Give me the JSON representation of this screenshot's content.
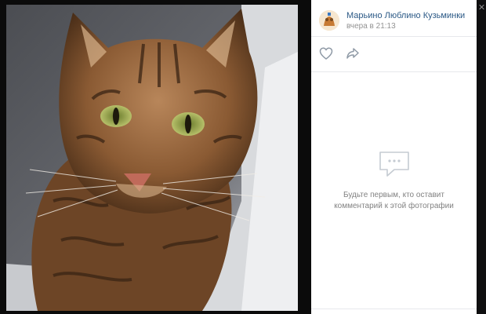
{
  "post": {
    "author": "Марьино Люблино Кузьминки",
    "date": "вчера в 21:13"
  },
  "icons": {
    "like": "heart-icon",
    "share": "share-arrow-icon",
    "comments": "comment-bubble-icon",
    "close": "close-icon"
  },
  "comments": {
    "empty_line1": "Будьте первым, кто оставит",
    "empty_line2": "комментарий к этой фотографии"
  },
  "colors": {
    "link": "#2a5885",
    "muted": "#939393",
    "panel_bg": "#ffffff",
    "backdrop": "#0f0f10"
  }
}
